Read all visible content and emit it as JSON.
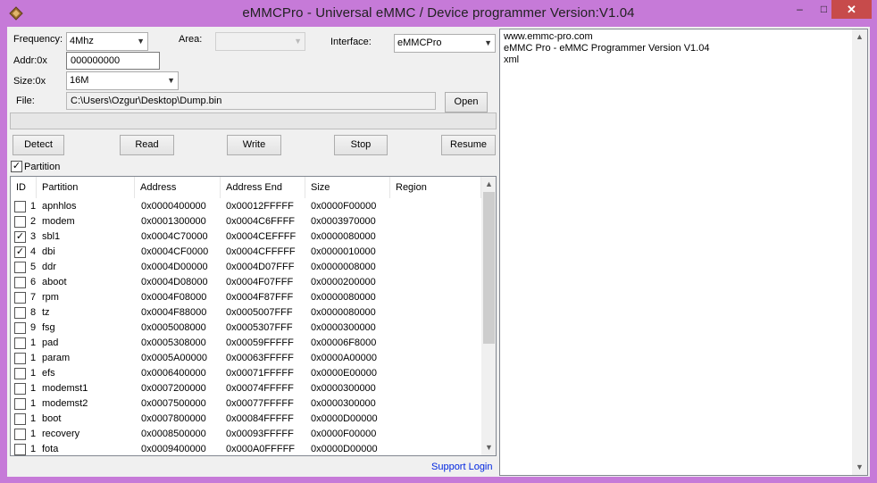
{
  "window": {
    "title": "eMMCPro - Universal eMMC / Device programmer  Version:V1.04"
  },
  "form": {
    "frequency_label": "Frequency:",
    "frequency_value": "4Mhz",
    "area_label": "Area:",
    "area_value": "",
    "interface_label": "Interface:",
    "interface_value": "eMMCPro",
    "addr_label": "Addr:0x",
    "addr_value": "000000000",
    "size_label": "Size:0x",
    "size_value": "16M",
    "file_label": "File:",
    "file_value": "C:\\Users\\Ozgur\\Desktop\\Dump.bin",
    "open_label": "Open"
  },
  "buttons": {
    "detect": "Detect",
    "read": "Read",
    "write": "Write",
    "stop": "Stop",
    "resume": "Resume"
  },
  "partition_toggle": {
    "label": "Partition",
    "checked": true
  },
  "table": {
    "columns": [
      "ID",
      "Partition",
      "Address",
      "Address End",
      "Size",
      "Region"
    ],
    "rows": [
      {
        "checked": false,
        "id": "1",
        "name": "apnhlos",
        "address": "0x0000400000",
        "end": "0x00012FFFFF",
        "size": "0x0000F00000",
        "region": ""
      },
      {
        "checked": false,
        "id": "2",
        "name": "modem",
        "address": "0x0001300000",
        "end": "0x0004C6FFFF",
        "size": "0x0003970000",
        "region": ""
      },
      {
        "checked": true,
        "id": "3",
        "name": "sbl1",
        "address": "0x0004C70000",
        "end": "0x0004CEFFFF",
        "size": "0x0000080000",
        "region": ""
      },
      {
        "checked": true,
        "id": "4",
        "name": "dbi",
        "address": "0x0004CF0000",
        "end": "0x0004CFFFFF",
        "size": "0x0000010000",
        "region": ""
      },
      {
        "checked": false,
        "id": "5",
        "name": "ddr",
        "address": "0x0004D00000",
        "end": "0x0004D07FFF",
        "size": "0x0000008000",
        "region": ""
      },
      {
        "checked": false,
        "id": "6",
        "name": "aboot",
        "address": "0x0004D08000",
        "end": "0x0004F07FFF",
        "size": "0x0000200000",
        "region": ""
      },
      {
        "checked": false,
        "id": "7",
        "name": "rpm",
        "address": "0x0004F08000",
        "end": "0x0004F87FFF",
        "size": "0x0000080000",
        "region": ""
      },
      {
        "checked": false,
        "id": "8",
        "name": "tz",
        "address": "0x0004F88000",
        "end": "0x0005007FFF",
        "size": "0x0000080000",
        "region": ""
      },
      {
        "checked": false,
        "id": "9",
        "name": "fsg",
        "address": "0x0005008000",
        "end": "0x0005307FFF",
        "size": "0x0000300000",
        "region": ""
      },
      {
        "checked": false,
        "id": "1",
        "name": "pad",
        "address": "0x0005308000",
        "end": "0x00059FFFFF",
        "size": "0x00006F8000",
        "region": ""
      },
      {
        "checked": false,
        "id": "1",
        "name": "param",
        "address": "0x0005A00000",
        "end": "0x00063FFFFF",
        "size": "0x0000A00000",
        "region": ""
      },
      {
        "checked": false,
        "id": "1",
        "name": "efs",
        "address": "0x0006400000",
        "end": "0x00071FFFFF",
        "size": "0x0000E00000",
        "region": ""
      },
      {
        "checked": false,
        "id": "1",
        "name": "modemst1",
        "address": "0x0007200000",
        "end": "0x00074FFFFF",
        "size": "0x0000300000",
        "region": ""
      },
      {
        "checked": false,
        "id": "1",
        "name": "modemst2",
        "address": "0x0007500000",
        "end": "0x00077FFFFF",
        "size": "0x0000300000",
        "region": ""
      },
      {
        "checked": false,
        "id": "1",
        "name": "boot",
        "address": "0x0007800000",
        "end": "0x00084FFFFF",
        "size": "0x0000D00000",
        "region": ""
      },
      {
        "checked": false,
        "id": "1",
        "name": "recovery",
        "address": "0x0008500000",
        "end": "0x00093FFFFF",
        "size": "0x0000F00000",
        "region": ""
      },
      {
        "checked": false,
        "id": "1",
        "name": "fota",
        "address": "0x0009400000",
        "end": "0x000A0FFFFF",
        "size": "0x0000D00000",
        "region": ""
      }
    ]
  },
  "support_link": "Support Login",
  "log": {
    "lines": [
      "www.emmc-pro.com",
      "eMMC Pro - eMMC Programmer Version V1.04",
      "xml"
    ]
  },
  "icons": {
    "app": "diamond-app-icon",
    "minimize": "minimize-icon",
    "maximize": "maximize-icon",
    "close": "close-icon"
  },
  "colors": {
    "frame": "#c67ad8",
    "close": "#c74b4b",
    "link": "#0026e0"
  }
}
